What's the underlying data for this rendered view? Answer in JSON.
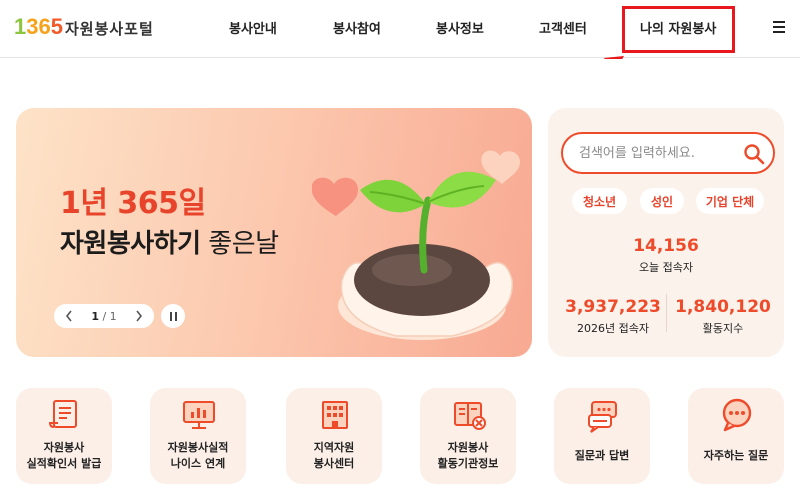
{
  "brand": {
    "logo_digit1": "1",
    "logo_digits_mid": "36",
    "logo_digit_last": "5",
    "logo_text": "자원봉사포털",
    "colors": {
      "green": "#8cc63f",
      "orange": "#f7a21b",
      "red_orange": "#f15a29"
    }
  },
  "nav": {
    "items": [
      {
        "label": "봉사안내"
      },
      {
        "label": "봉사참여"
      },
      {
        "label": "봉사정보"
      },
      {
        "label": "고객센터"
      },
      {
        "label": "나의 자원봉사"
      }
    ],
    "menu_icon": "hamburger-menu-icon"
  },
  "annotation": {
    "highlight_color": "#e8181e",
    "target": "나의 자원봉사"
  },
  "banner": {
    "title_line1": "1년 365일",
    "title_line2_bold": "자원봉사하기",
    "title_line2_rest": " 좋은날",
    "slide_current": "1",
    "slide_separator": " / ",
    "slide_total": "1",
    "illustration": "sprout-in-hands-illustration"
  },
  "search": {
    "placeholder": "검색어를 입력하세요.",
    "value": "",
    "icon": "search-icon"
  },
  "filters": [
    {
      "label": "청소년"
    },
    {
      "label": "성인"
    },
    {
      "label": "기업 단체"
    }
  ],
  "stats": {
    "today_visitors": {
      "value": "14,156",
      "label": "오늘 접속자"
    },
    "year_visitors": {
      "value": "3,937,223",
      "label": "2026년 접속자"
    },
    "active_count": {
      "value": "1,840,120",
      "label": "활동지수"
    }
  },
  "quick_links": [
    {
      "label": "자원봉사\n실적확인서 발급",
      "icon": "certificate-scroll-icon"
    },
    {
      "label": "자원봉사실적\n나이스 연계",
      "icon": "monitor-chart-icon"
    },
    {
      "label": "지역자원\n봉사센터",
      "icon": "building-icon"
    },
    {
      "label": "자원봉사\n활동기관정보",
      "icon": "info-book-icon"
    },
    {
      "label": "질문과 답변",
      "icon": "chat-bubbles-icon"
    },
    {
      "label": "자주하는 질문",
      "icon": "speech-bubble-dots-icon"
    }
  ],
  "accent_color": "#ee4b2b"
}
